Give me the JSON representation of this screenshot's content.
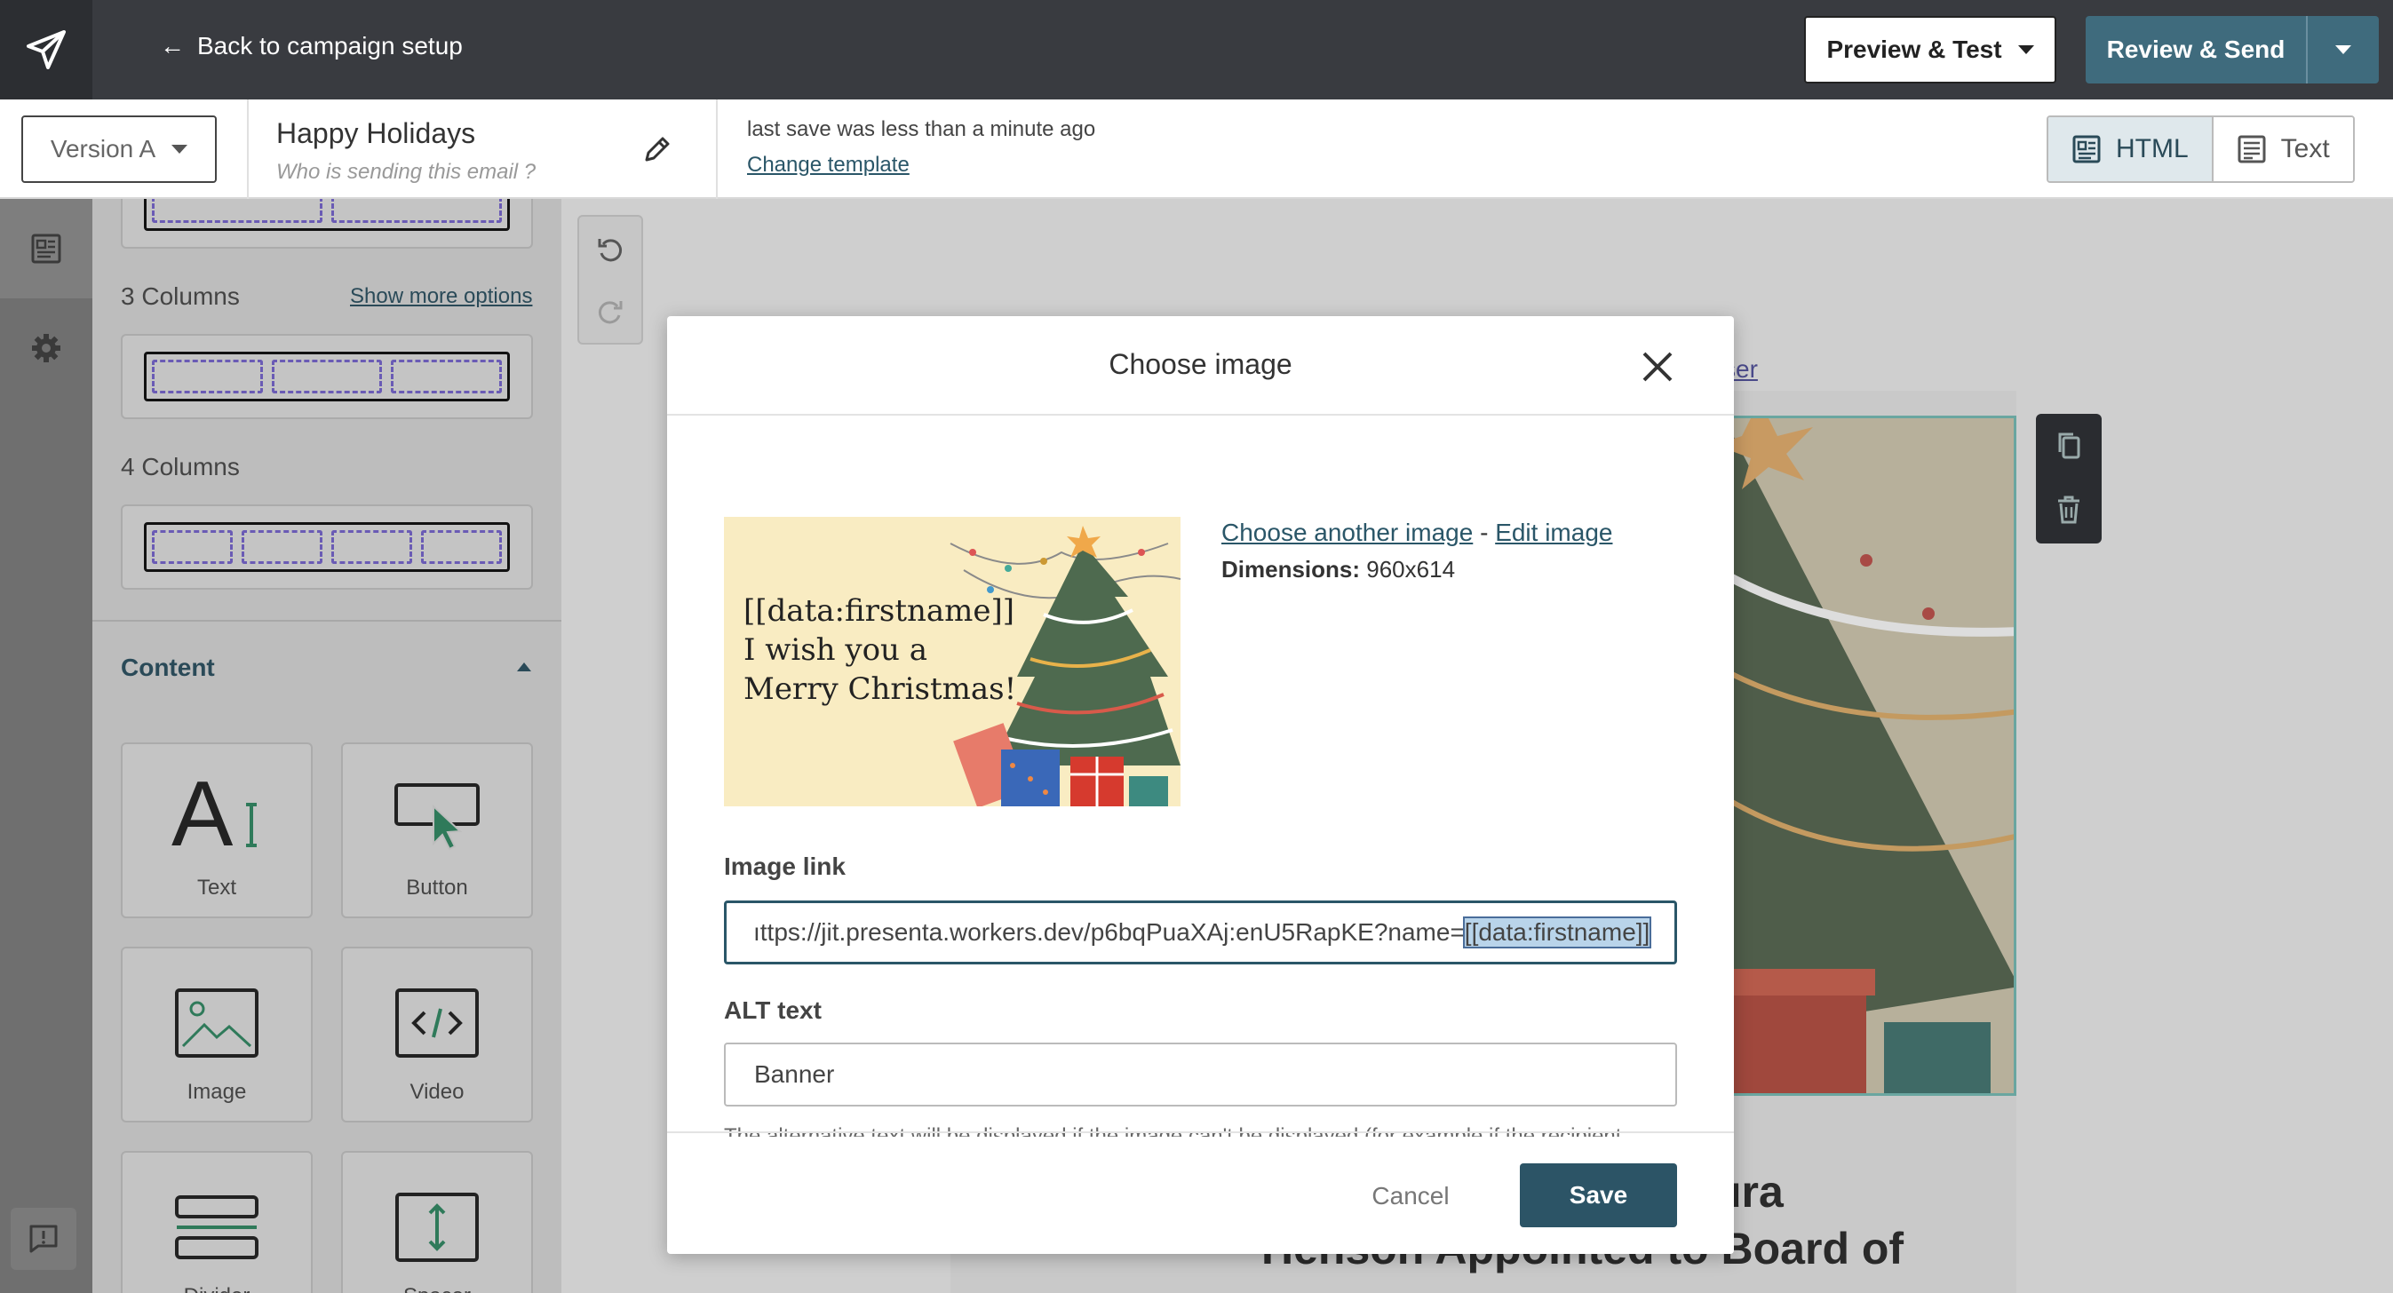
{
  "topbar": {
    "back_label": "Back to campaign setup",
    "preview_label": "Preview & Test",
    "send_label": "Review & Send"
  },
  "secbar": {
    "version_label": "Version A",
    "email_name": "Happy Holidays",
    "sender_placeholder": "Who is sending this email ?",
    "save_status": "last save was less than a minute ago",
    "change_template": "Change template",
    "mode_html": "HTML",
    "mode_text": "Text"
  },
  "panel": {
    "three_columns": "3 Columns",
    "show_more": "Show more options",
    "four_columns": "4 Columns",
    "content_heading": "Content",
    "tiles": [
      "Text",
      "Button",
      "Image",
      "Video",
      "Divider",
      "Spacer"
    ]
  },
  "canvas": {
    "browser_link_fragment": "ser",
    "headline_line1": "ura",
    "headline_line2": "Henson Appointed to Board of"
  },
  "modal": {
    "title": "Choose image",
    "preview_text": [
      "[[data:firstname]]",
      "I wish you a",
      "Merry Christmas!"
    ],
    "choose_another": "Choose another image",
    "separator": " - ",
    "edit_image": "Edit image",
    "dimensions_label": "Dimensions:",
    "dimensions_value": "960x614",
    "image_link_label": "Image link",
    "image_link_value_plain": "ıttps://jit.presenta.workers.dev/p6bqPuaXAj:enU5RapKE?name=",
    "image_link_value_selected": "[[data:firstname]]",
    "alt_label": "ALT text",
    "alt_value": "Banner",
    "alt_help": "The alternative text will be displayed if the image can't be displayed (for example if the recipient",
    "cancel_label": "Cancel",
    "save_label": "Save"
  },
  "colors": {
    "brand_dark": "#2c5466",
    "accent": "#3f6b7d",
    "topbar": "#393b40"
  }
}
